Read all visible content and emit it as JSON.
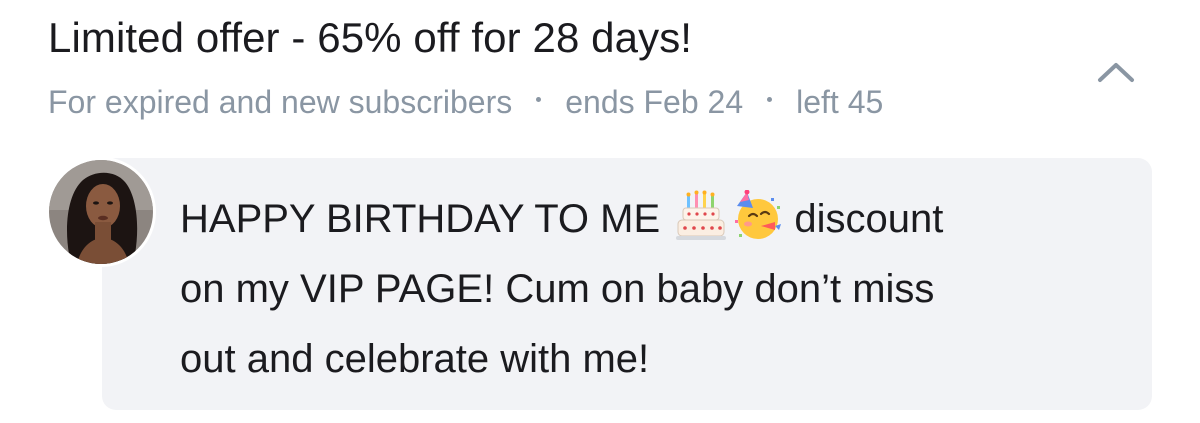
{
  "offer": {
    "title": "Limited offer - 65% off for 28 days!",
    "audience": "For expired and new subscribers",
    "ends": "ends Feb 24",
    "left": "left 45",
    "collapse_icon": "chevron-up-icon"
  },
  "message": {
    "line1_prefix": "HAPPY BIRTHDAY TO ME",
    "emojis": [
      "birthday-cake-icon",
      "partying-face-icon"
    ],
    "line1_suffix": "discount",
    "line2": "on my VIP PAGE! Cum on baby don’t miss",
    "line3": "out and celebrate with me!"
  },
  "colors": {
    "title": "#1b1b1f",
    "meta": "#8a96a3",
    "bubble": "#f2f3f6",
    "chevron": "#8a96a3"
  }
}
